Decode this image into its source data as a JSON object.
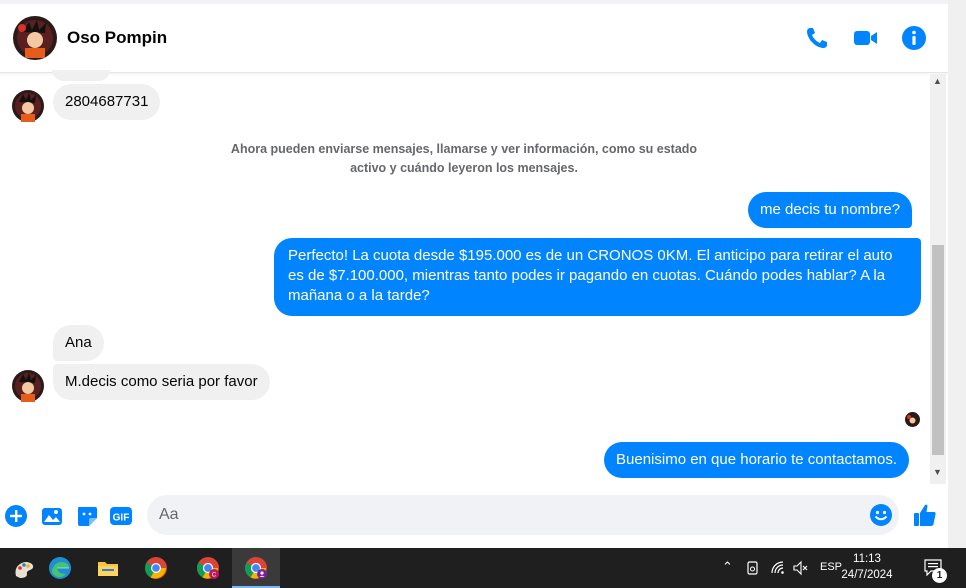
{
  "header": {
    "contact_name": "Oso Pompin"
  },
  "messages": {
    "phone": "2804687731",
    "notice": "Ahora pueden enviarse mensajes, llamarse y ver información, como su estado activo y cuándo leyeron los mensajes.",
    "out_name_question": "me decis tu nombre?",
    "out_offer": "Perfecto! La cuota desde $195.000 es de un CRONOS 0KM. El anticipo para retirar el auto es de $7.100.000, mientras tanto podes ir pagando en cuotas. Cuándo podes hablar? A la mañana o a la tarde?",
    "in_name": "Ana",
    "in_question": "M.decis como seria por favor",
    "out_last": "Buenisimo en que horario te contactamos."
  },
  "composer": {
    "placeholder": "Aa"
  },
  "taskbar": {
    "lang": "ESP",
    "time": "11:13",
    "date": "24/7/2024",
    "notif_count": "1"
  },
  "colors": {
    "accent": "#0084ff",
    "incoming_bubble": "#f0f0f0",
    "taskbar": "#1f1f1f"
  }
}
